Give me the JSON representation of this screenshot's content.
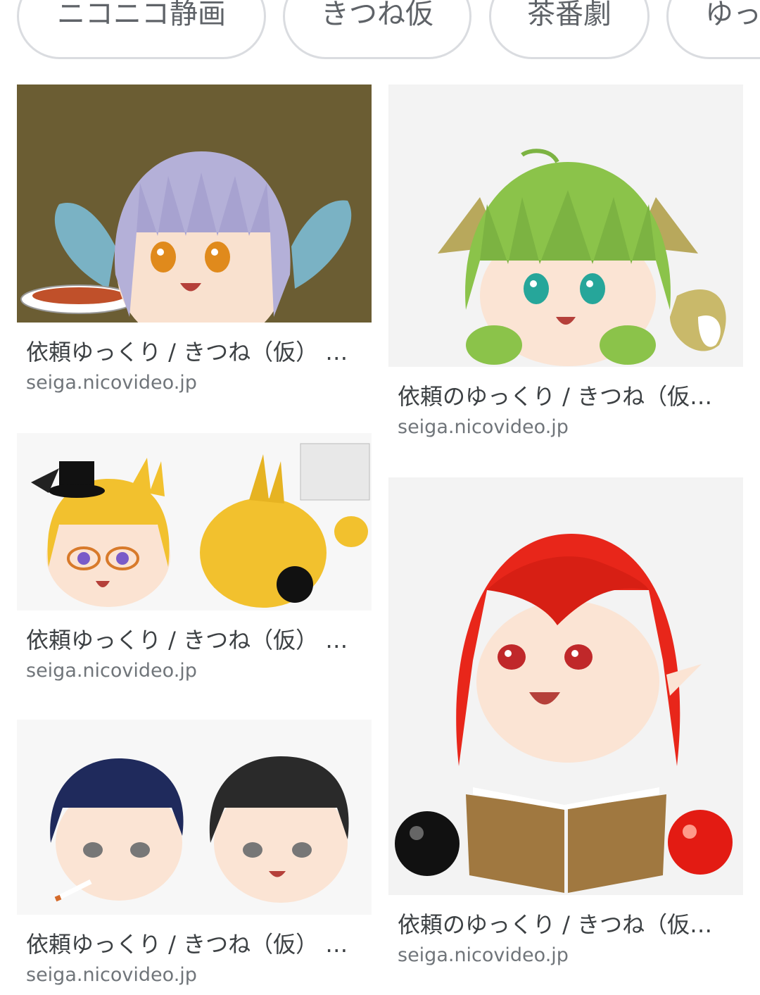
{
  "chips": [
    "ニコニコ静画",
    "きつね仮",
    "茶番劇",
    "ゆっ"
  ],
  "results": [
    {
      "title": "依頼ゆっくり / きつね（仮） …",
      "source": "seiga.nicovideo.jp"
    },
    {
      "title": "依頼のゆっくり / きつね（仮…",
      "source": "seiga.nicovideo.jp"
    },
    {
      "title": "依頼ゆっくり / きつね（仮） …",
      "source": "seiga.nicovideo.jp"
    },
    {
      "title": "依頼ゆっくり / きつね（仮） …",
      "source": "seiga.nicovideo.jp"
    },
    {
      "title": "依頼のゆっくり / きつね（仮…",
      "source": "seiga.nicovideo.jp"
    }
  ],
  "colors": {
    "chip_border": "#dadce0",
    "chip_text": "#5f6368",
    "title_text": "#3c4043",
    "source_text": "#70757a"
  }
}
